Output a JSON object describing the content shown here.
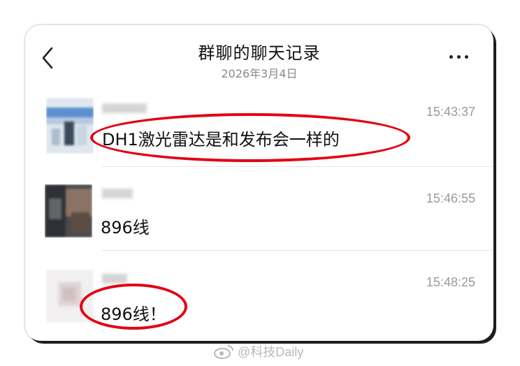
{
  "header": {
    "title": "群聊的聊天记录",
    "date": "2026年3月4日"
  },
  "messages": [
    {
      "time": "15:43:37",
      "text": "DH1激光雷达是和发布会一样的"
    },
    {
      "time": "15:46:55",
      "text": "896线"
    },
    {
      "time": "15:48:25",
      "text": "896线！"
    }
  ],
  "watermark": {
    "handle": "@科技Daily"
  },
  "colors": {
    "highlight": "#e30012"
  }
}
